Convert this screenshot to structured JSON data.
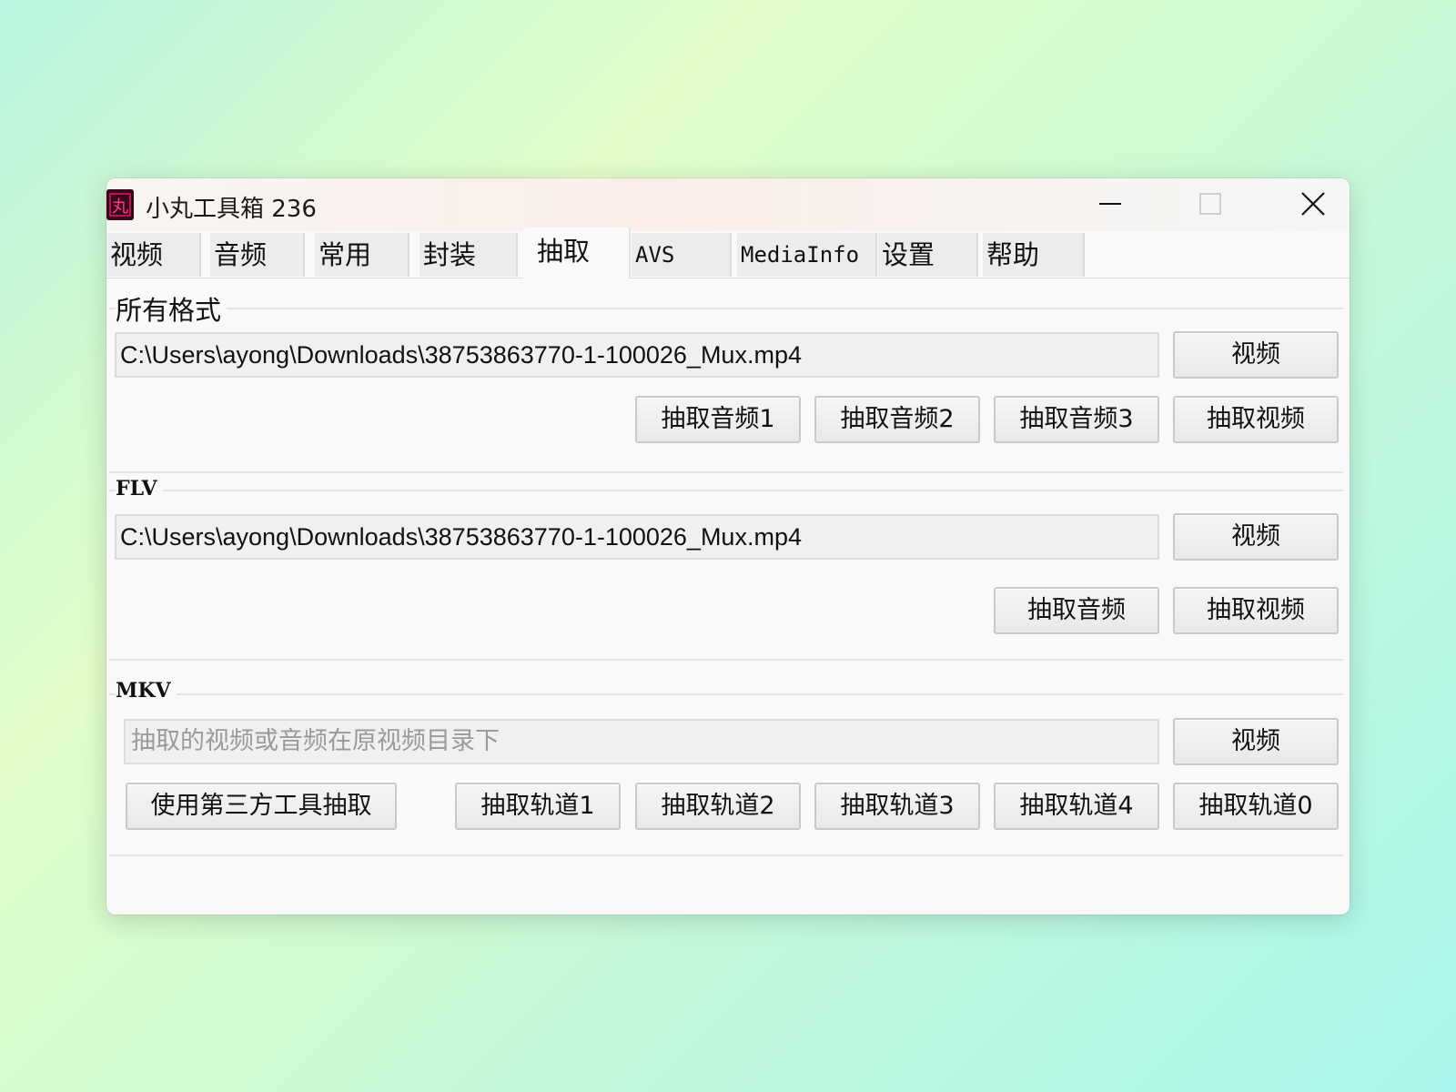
{
  "window": {
    "title": "小丸工具箱 236",
    "icon_glyph": "丸"
  },
  "tabs": [
    {
      "label": "视频"
    },
    {
      "label": "音频"
    },
    {
      "label": "常用"
    },
    {
      "label": "封装"
    },
    {
      "label": "抽取",
      "selected": true
    },
    {
      "label": "AVS"
    },
    {
      "label": "MediaInfo"
    },
    {
      "label": "设置"
    },
    {
      "label": "帮助"
    }
  ],
  "all_formats": {
    "group_label": "所有格式",
    "path": "C:\\Users\\ayong\\Downloads\\38753863770-1-100026_Mux.mp4",
    "video_button": "视频",
    "buttons": [
      "抽取音频1",
      "抽取音频2",
      "抽取音频3",
      "抽取视频"
    ]
  },
  "flv": {
    "group_label": "FLV",
    "path": "C:\\Users\\ayong\\Downloads\\38753863770-1-100026_Mux.mp4",
    "video_button": "视频",
    "buttons": [
      "抽取音频",
      "抽取视频"
    ]
  },
  "mkv": {
    "group_label": "MKV",
    "placeholder": "抽取的视频或音频在原视频目录下",
    "video_button": "视频",
    "third_party_button": "使用第三方工具抽取",
    "track_buttons": [
      "抽取轨道1",
      "抽取轨道2",
      "抽取轨道3",
      "抽取轨道4",
      "抽取轨道0"
    ]
  },
  "icons": {
    "app": "app-logo-icon",
    "minimize": "minimize-icon",
    "maximize": "maximize-icon",
    "close": "close-icon"
  },
  "colors": {
    "icon_bg": "#3a0718",
    "icon_accent": "#e8156b"
  }
}
